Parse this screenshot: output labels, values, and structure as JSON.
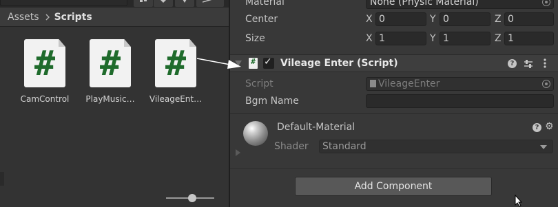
{
  "project": {
    "breadcrumb": {
      "root": "Assets",
      "current": "Scripts"
    },
    "assets": [
      {
        "label": "CamControl",
        "icon": "csharp-script-icon",
        "glyph": "#"
      },
      {
        "label": "PlayMusic…",
        "icon": "csharp-script-icon",
        "glyph": "#"
      },
      {
        "label": "VileageEnt…",
        "icon": "csharp-script-icon",
        "glyph": "#"
      }
    ],
    "zoom_slider_value": 0.55
  },
  "inspector": {
    "collider": {
      "material_label": "Material",
      "material_value": "None (Physic Material)",
      "center_label": "Center",
      "center": {
        "x": "0",
        "y": "0",
        "z": "0"
      },
      "size_label": "Size",
      "size": {
        "x": "1",
        "y": "1",
        "z": "1"
      },
      "axis_letters": {
        "x": "X",
        "y": "Y",
        "z": "Z"
      }
    },
    "script_component": {
      "title": "Vileage Enter (Script)",
      "enabled": true,
      "check_glyph": "✓",
      "help_glyph": "?",
      "script_label": "Script",
      "script_value": "VileageEnter",
      "bgm_label": "Bgm Name",
      "bgm_value": ""
    },
    "material": {
      "name": "Default-Material",
      "shader_label": "Shader",
      "shader_value": "Standard"
    },
    "add_component_label": "Add Component"
  },
  "colors": {
    "script_green": "#1f6b2c",
    "panel_bg": "#383838",
    "button_bg": "#585858"
  }
}
